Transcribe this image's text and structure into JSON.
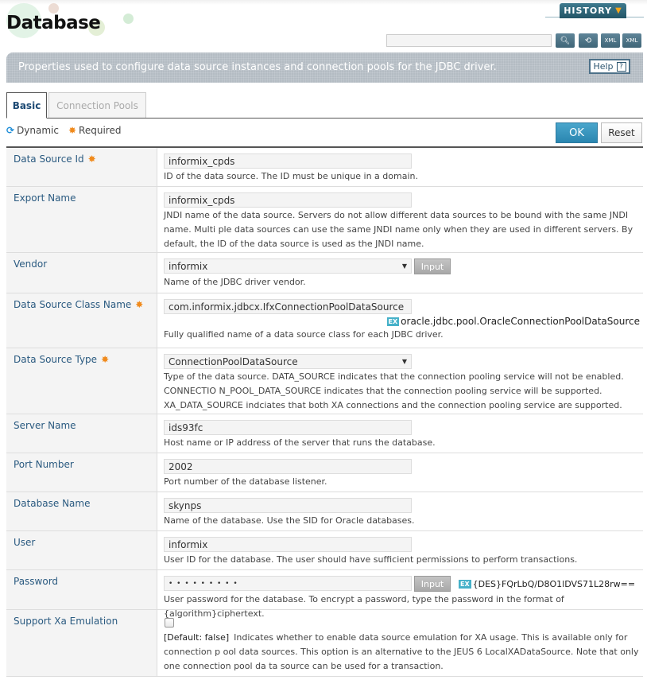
{
  "header": {
    "title": "Database",
    "history_label": "HISTORY",
    "search_placeholder": "",
    "toolbar_icons": [
      "search-icon",
      "refresh-icon",
      "xml-export-icon",
      "xml-import-icon"
    ]
  },
  "description_bar": {
    "text": "Properties used to configure data source instances and connection pools for the JDBC driver.",
    "help_label": "Help",
    "help_icon": "?"
  },
  "tabs": [
    {
      "label": "Basic",
      "active": true
    },
    {
      "label": "Connection Pools",
      "active": false
    }
  ],
  "legend": {
    "dynamic_label": "Dynamic",
    "required_label": "Required"
  },
  "actions": {
    "ok_label": "OK",
    "reset_label": "Reset"
  },
  "colors": {
    "accent_blue": "#2a86b0",
    "label_blue": "#2a5a80",
    "required_orange": "#f08a1c",
    "history_teal": "#235567",
    "ex_badge": "#46b1c9"
  },
  "fields": {
    "data_source_id": {
      "label": "Data Source Id",
      "required": true,
      "value": "informix_cpds",
      "desc": "ID of the data source. The ID must be unique in a domain."
    },
    "export_name": {
      "label": "Export Name",
      "value": "informix_cpds",
      "desc": "JNDI name of the data source. Servers do not allow different data sources to be bound with the same JNDI name. Multi ple data sources can use the same JNDI name only when they are used in different servers. By default, the ID of the data source is used as the JNDI name."
    },
    "vendor": {
      "label": "Vendor",
      "value": "informix",
      "input_label": "Input",
      "desc": "Name of the JDBC driver vendor."
    },
    "data_source_class_name": {
      "label": "Data Source Class Name",
      "required": true,
      "value": "com.informix.jdbcx.IfxConnectionPoolDataSource",
      "ex_badge": "EX",
      "example": "oracle.jdbc.pool.OracleConnectionPoolDataSource",
      "desc": "Fully qualified name of a data source class for each JDBC driver."
    },
    "data_source_type": {
      "label": "Data Source Type",
      "required": true,
      "value": "ConnectionPoolDataSource",
      "desc": "Type of the data source. DATA_SOURCE indicates that the connection pooling service will not be enabled. CONNECTIO N_POOL_DATA_SOURCE indicates that the connection pooling service will be supported. XA_DATA_SOURCE indciates that both XA connections and the connection pooling service are supported."
    },
    "server_name": {
      "label": "Server Name",
      "value": "ids93fc",
      "desc": "Host name or IP address of the server that runs the database."
    },
    "port_number": {
      "label": "Port Number",
      "value": "2002",
      "desc": "Port number of the database listener."
    },
    "database_name": {
      "label": "Database Name",
      "value": "skynps",
      "desc": "Name of the database. Use the SID for Oracle databases."
    },
    "user": {
      "label": "User",
      "value": "informix",
      "desc": "User ID for the database. The user should have sufficient permissions to perform transactions."
    },
    "password": {
      "label": "Password",
      "value": "• • • • • • • • •",
      "input_label": "Input",
      "ex_badge": "EX",
      "example": "{DES}FQrLbQ/D8O1lDVS71L28rw==",
      "desc": "User password for the database. To encrypt a password, type the password in the format of {algorithm}ciphertext."
    },
    "support_xa_emulation": {
      "label": "Support Xa Emulation",
      "checked": false,
      "default_tag": "[Default: false]",
      "desc": "Indicates whether to enable data source emulation for XA usage. This is available only for connection p ool data sources. This option is an alternative to the JEUS 6 LocalXADataSource. Note that only one connection pool da ta source can be used for a transaction."
    }
  }
}
